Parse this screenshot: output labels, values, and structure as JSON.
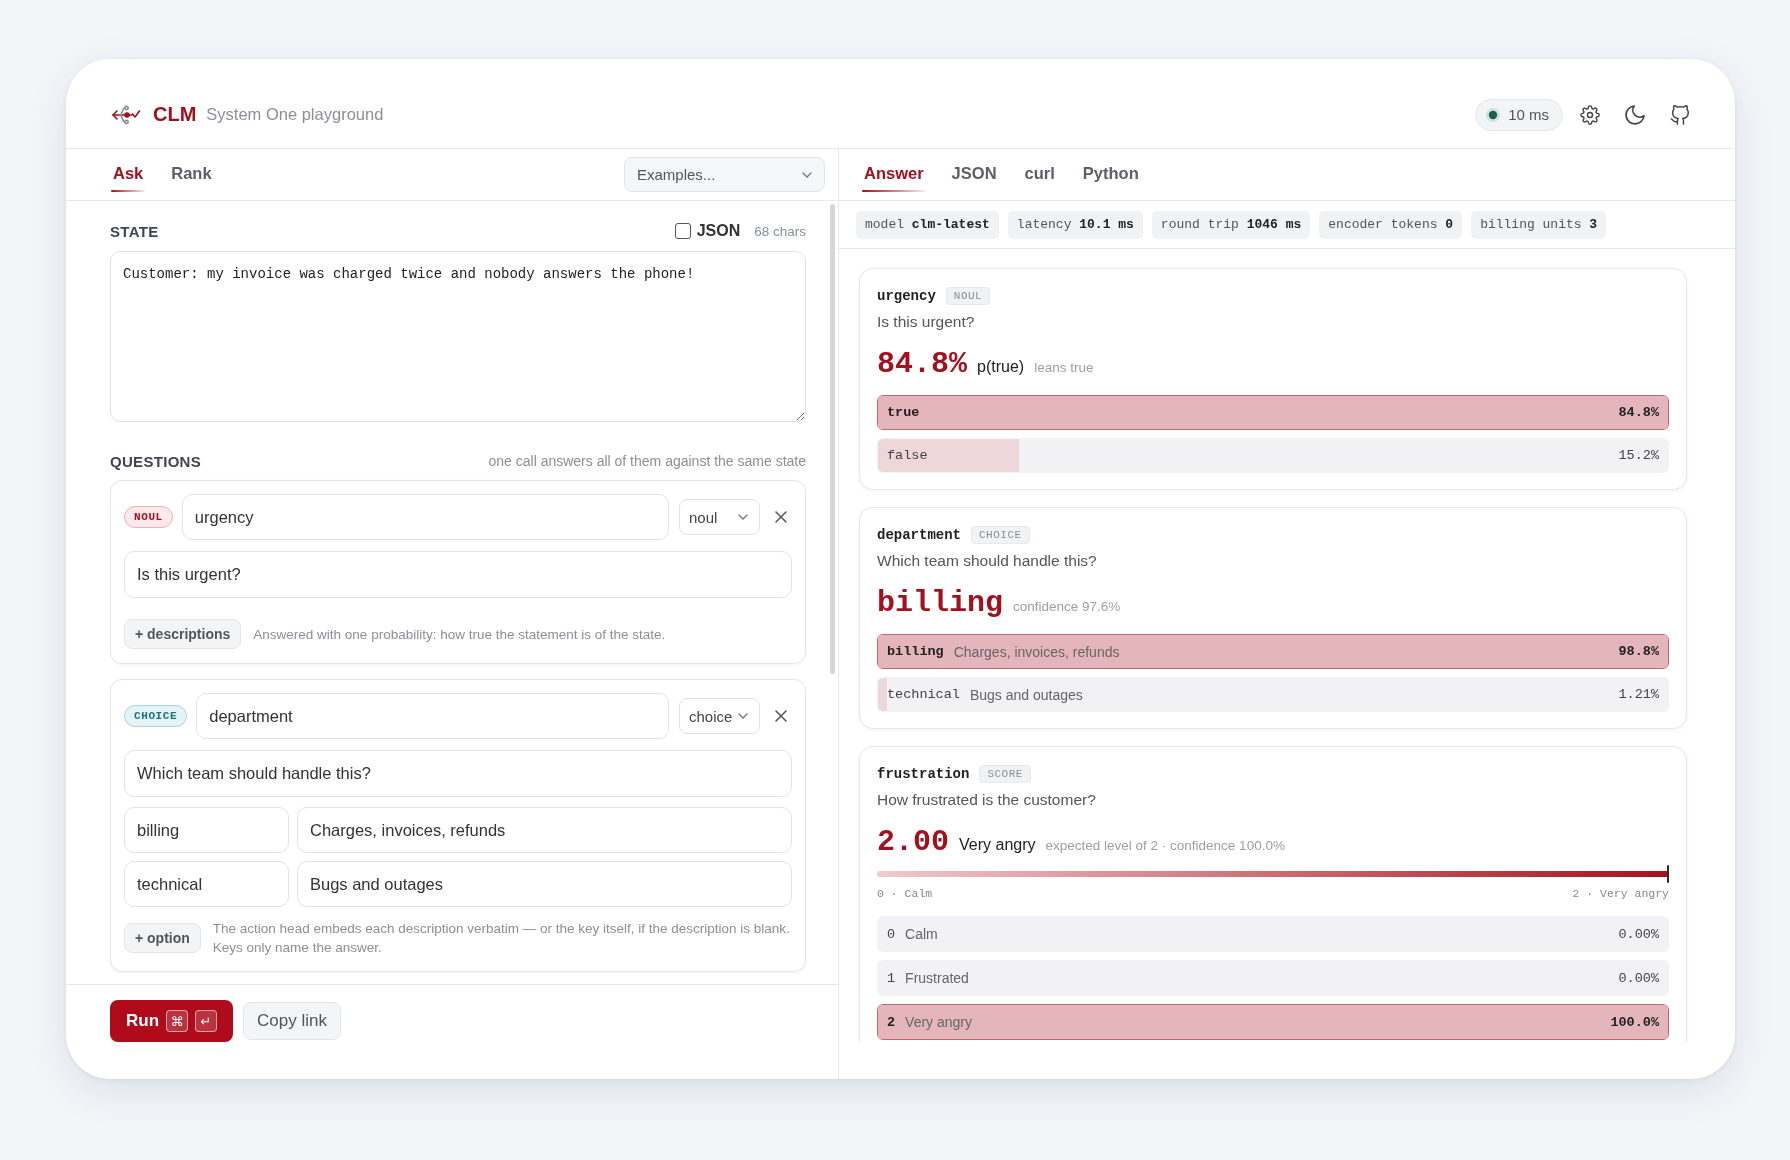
{
  "header": {
    "title": "CLM",
    "subtitle": "System One playground",
    "latency": "10 ms"
  },
  "left_tabs": [
    {
      "label": "Ask",
      "selected": true
    },
    {
      "label": "Rank",
      "selected": false
    }
  ],
  "examples_select": {
    "label": "Examples..."
  },
  "state": {
    "label": "STATE",
    "json_checked": false,
    "json_label": "JSON",
    "char_count": "68 chars",
    "text": "Customer: my invoice was charged twice and nobody answers the phone!"
  },
  "questions": {
    "label": "QUESTIONS",
    "note": "one call answers all of them against the same state",
    "items": [
      {
        "kind": "noul",
        "badge": "NOUL",
        "key": "urgency",
        "type": "noul",
        "question": "Is this urgent?",
        "add_button": "+ descriptions",
        "hint": "Answered with one probability: how true the statement is of the state."
      },
      {
        "kind": "choice",
        "badge": "CHOICE",
        "key": "department",
        "type": "choice",
        "question": "Which team should handle this?",
        "options": [
          {
            "key": "billing",
            "description": "Charges, invoices, refunds"
          },
          {
            "key": "technical",
            "description": "Bugs and outages"
          }
        ],
        "add_button": "+ option",
        "hint": "The action head embeds each description verbatim — or the key itself, if the description is blank. Keys only name the answer."
      }
    ]
  },
  "actions": {
    "run": "Run",
    "shortcut": [
      "⌘",
      "↵"
    ],
    "copy": "Copy link"
  },
  "answer_tabs": [
    {
      "label": "Answer",
      "selected": true
    },
    {
      "label": "JSON",
      "selected": false
    },
    {
      "label": "curl",
      "selected": false
    },
    {
      "label": "Python",
      "selected": false
    }
  ],
  "stats": [
    "model **clm-latest**",
    "latency **10.1 ms**",
    "round trip **1046 ms**",
    "encoder tokens **0**",
    "billing units **3**"
  ],
  "results": [
    {
      "kind": "noul",
      "key": "urgency",
      "badge": "NOUL",
      "question": "Is this urgent?",
      "headline": {
        "value": "84.8%",
        "label": "p(true)",
        "note": "leans true"
      },
      "bars": [
        {
          "label": "true",
          "value": "84.8%",
          "level": 1,
          "winner": true
        },
        {
          "label": "false",
          "value": "15.2%",
          "level": 0.179,
          "winner": false
        }
      ]
    },
    {
      "kind": "choice",
      "key": "department",
      "badge": "CHOICE",
      "question": "Which team should handle this?",
      "headline": {
        "value": "billing",
        "note": "confidence 97.6%"
      },
      "bars": [
        {
          "label": "billing",
          "description": "Charges, invoices, refunds",
          "value": "98.8%",
          "level": 1,
          "winner": true
        },
        {
          "label": "technical",
          "description": "Bugs and outages",
          "value": "1.21%",
          "level": 0.012,
          "winner": false
        }
      ]
    },
    {
      "kind": "score",
      "key": "frustration",
      "badge": "SCORE",
      "question": "How frustrated is the customer?",
      "headline": {
        "value": "2.00",
        "label": "Very angry",
        "note": "expected level of 2 · confidence 100.0%"
      },
      "gauge": {
        "level": 1,
        "min_label": "0 · Calm",
        "max_label": "2 · Very angry"
      },
      "bars": [
        {
          "label": "0",
          "description": "Calm",
          "value": "0.00%",
          "level": 0,
          "winner": false
        },
        {
          "label": "1",
          "description": "Frustrated",
          "value": "0.00%",
          "level": 0,
          "winner": false
        },
        {
          "label": "2",
          "description": "Very angry",
          "value": "100.0%",
          "level": 1,
          "winner": true
        }
      ]
    }
  ]
}
